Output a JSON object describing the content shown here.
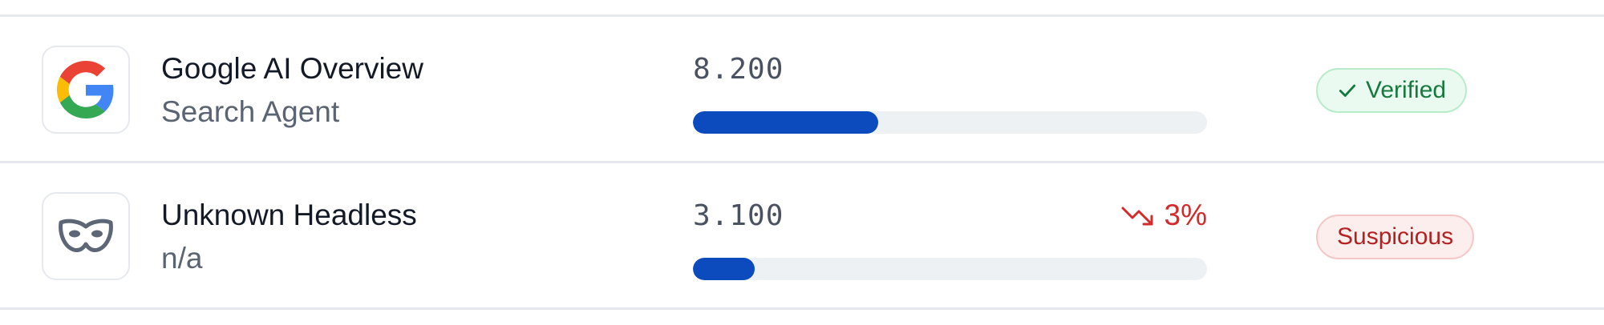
{
  "rows": [
    {
      "icon": "google-g-icon",
      "name": "Google AI Overview",
      "type": "Search Agent",
      "score": "8.200",
      "score_fraction": 0.36,
      "trend": null,
      "status": "Verified",
      "status_icon": "check-icon"
    },
    {
      "icon": "mask-icon",
      "name": "Unknown Headless",
      "type": "n/a",
      "score": "3.100",
      "score_fraction": 0.12,
      "trend": "3%",
      "trend_icon": "trending-down-icon",
      "status": "Suspicious"
    }
  ],
  "colors": {
    "bar_fill": "#0b4bbd",
    "bar_track": "#eef1f4",
    "verified_text": "#167a3e",
    "suspicious_text": "#b42121",
    "trend_down": "#d12b2b"
  }
}
